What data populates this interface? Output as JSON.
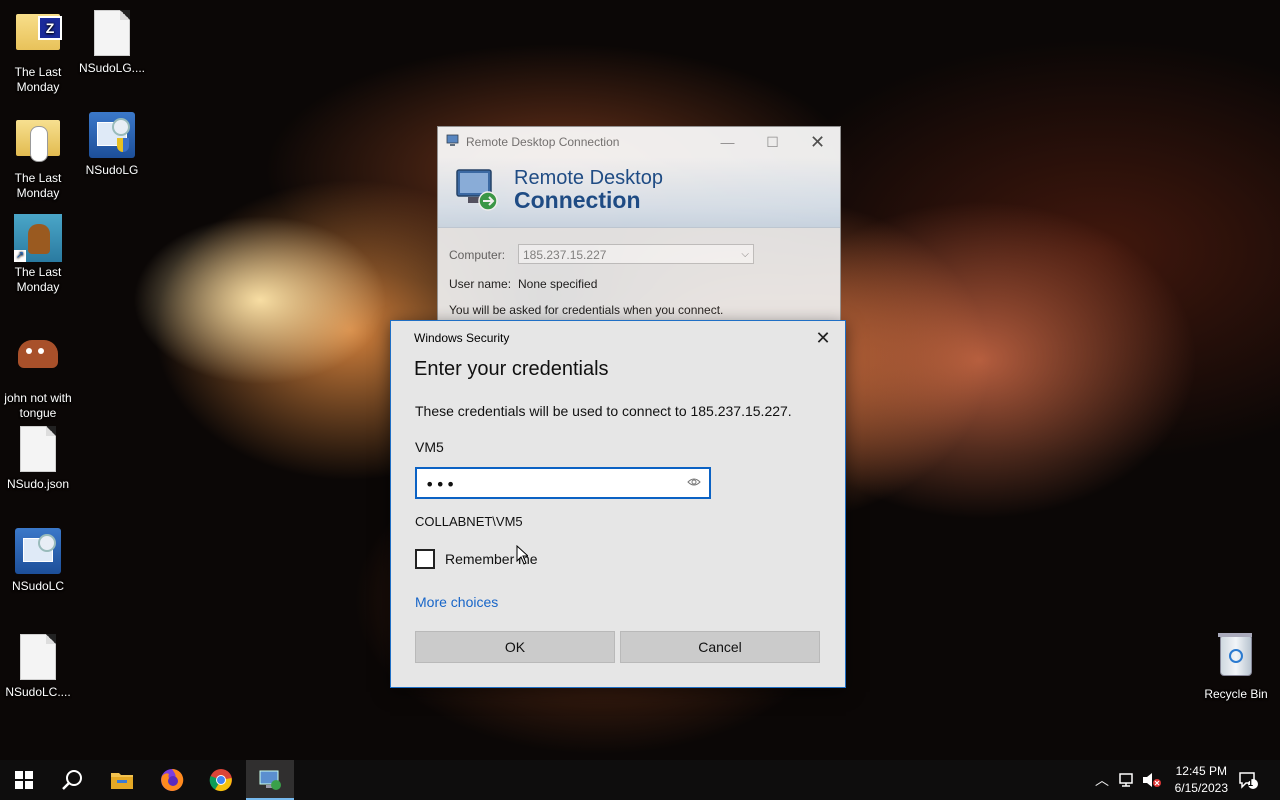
{
  "desktop": {
    "icons": [
      {
        "label": "The Last Monday",
        "icon": "zip-folder-icon"
      },
      {
        "label": "NSudoLG....",
        "icon": "file-icon"
      },
      {
        "label": "The Last Monday",
        "icon": "audio-file-icon"
      },
      {
        "label": "NSudoLG",
        "icon": "nsudo-app-icon"
      },
      {
        "label": "The Last Monday",
        "icon": "picture-shortcut-icon"
      },
      {
        "label": "john not with tongue",
        "icon": "image-icon"
      },
      {
        "label": "NSudo.json",
        "icon": "file-icon"
      },
      {
        "label": "NSudoLC",
        "icon": "nsudo-app-icon"
      },
      {
        "label": "NSudoLC....",
        "icon": "file-icon"
      },
      {
        "label": "Recycle Bin",
        "icon": "recycle-bin-icon"
      }
    ]
  },
  "rdp": {
    "title": "Remote Desktop Connection",
    "banner_line1": "Remote Desktop",
    "banner_line2": "Connection",
    "computer_label": "Computer:",
    "computer_value": "185.237.15.227",
    "username_label": "User name:",
    "username_value": "None specified",
    "info": "You will be asked for credentials when you connect."
  },
  "security": {
    "title": "Windows Security",
    "heading": "Enter your credentials",
    "description": "These credentials will be used to connect to 185.237.15.227.",
    "user": "VM5",
    "password_value": "•••",
    "domain": "COLLABNET\\VM5",
    "remember_label": "Remember me",
    "remember_checked": false,
    "more_choices": "More choices",
    "ok_label": "OK",
    "cancel_label": "Cancel"
  },
  "taskbar": {
    "apps": [
      "start-icon",
      "search-icon",
      "file-explorer-icon",
      "firefox-icon",
      "chrome-icon",
      "remote-desktop-icon"
    ],
    "active_app": "remote-desktop-icon",
    "time": "12:45 PM",
    "date": "6/15/2023",
    "notification_count": "1"
  }
}
